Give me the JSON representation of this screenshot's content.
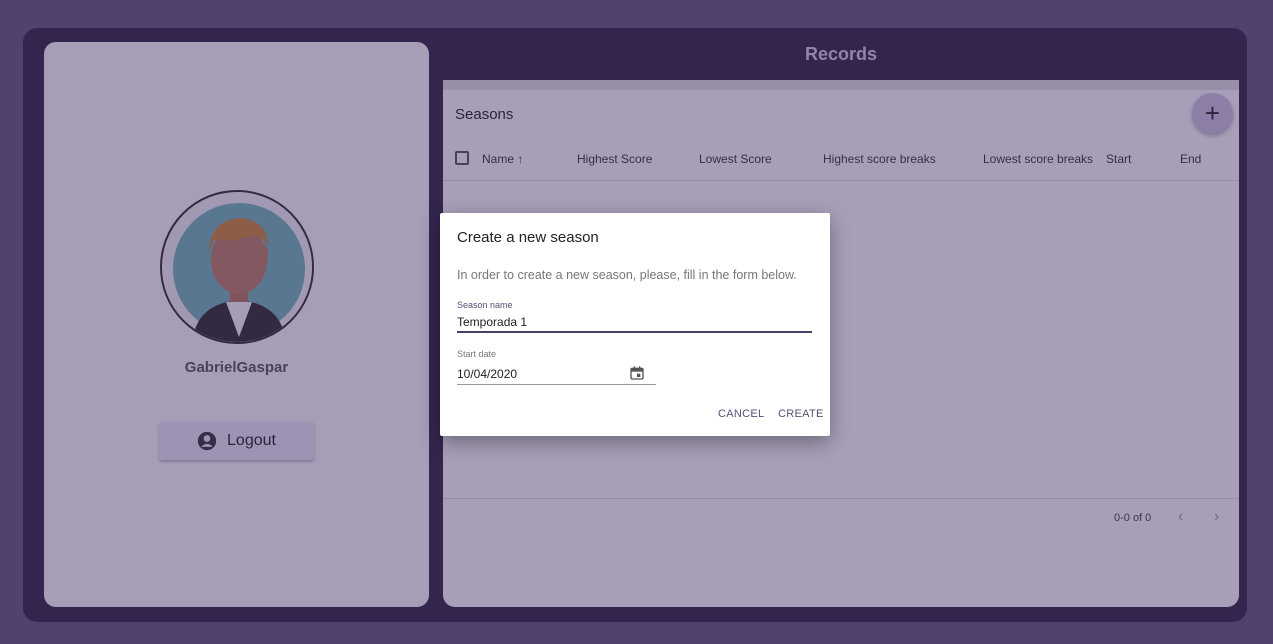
{
  "user": {
    "username": "GabrielGaspar",
    "logout_label": "Logout"
  },
  "records": {
    "title": "Records"
  },
  "table": {
    "title": "Seasons",
    "columns": [
      "Name",
      "Highest Score",
      "Lowest Score",
      "Highest score breaks",
      "Lowest score breaks",
      "Start",
      "End"
    ],
    "sort_column": "Name",
    "pagination_range": "0-0 of 0"
  },
  "dialog": {
    "title": "Create a new season",
    "description": "In order to create a new season, please, fill in the form below.",
    "season_name_label": "Season name",
    "season_name_value": "Temporada 1",
    "start_date_label": "Start date",
    "start_date_value": "10/04/2020",
    "cancel_label": "CANCEL",
    "create_label": "CREATE"
  },
  "colors": {
    "frame": "#2f2440",
    "accent": "#5a4d78",
    "overlay": "#3c2864"
  },
  "icons": {
    "logout": "account-circle-icon",
    "add": "plus-icon",
    "sort": "arrow-up-icon",
    "calendar": "calendar-icon",
    "prev": "chevron-left-icon",
    "next": "chevron-right-icon"
  }
}
